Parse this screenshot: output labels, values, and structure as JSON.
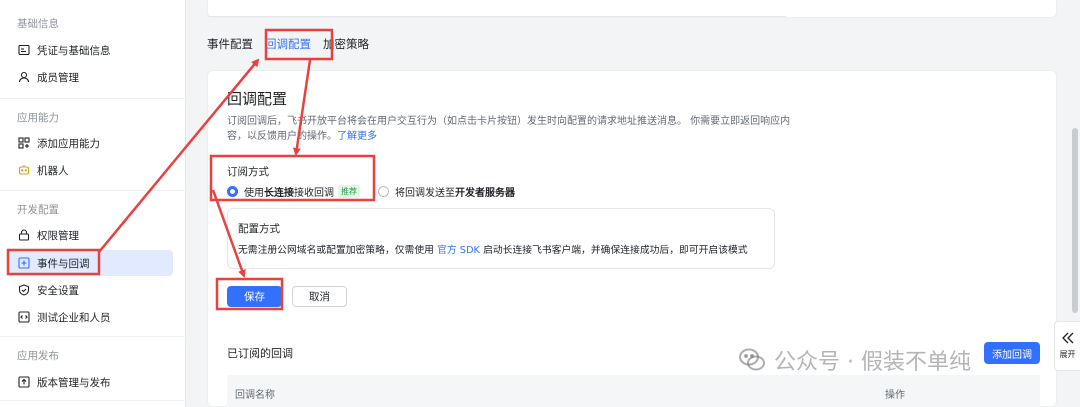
{
  "sidebar": {
    "groups": [
      {
        "title": "基础信息",
        "items": [
          {
            "label": "凭证与基础信息",
            "icon": "credential-icon"
          },
          {
            "label": "成员管理",
            "icon": "user-icon"
          }
        ]
      },
      {
        "title": "应用能力",
        "items": [
          {
            "label": "添加应用能力",
            "icon": "grid-add-icon"
          },
          {
            "label": "机器人",
            "icon": "robot-icon"
          }
        ]
      },
      {
        "title": "开发配置",
        "items": [
          {
            "label": "权限管理",
            "icon": "lock-icon"
          },
          {
            "label": "事件与回调",
            "icon": "event-icon",
            "active": true
          },
          {
            "label": "安全设置",
            "icon": "shield-icon"
          },
          {
            "label": "测试企业和人员",
            "icon": "code-icon"
          }
        ]
      },
      {
        "title": "应用发布",
        "items": [
          {
            "label": "版本管理与发布",
            "icon": "upload-icon"
          }
        ]
      }
    ]
  },
  "tabs": [
    {
      "label": "事件配置"
    },
    {
      "label": "回调配置",
      "active": true
    },
    {
      "label": "加密策略"
    }
  ],
  "main": {
    "title": "回调配置",
    "desc_line1": "订阅回调后，飞书开放平台将会在用户交互行为（如点击卡片按钮）发生时向配置的请求地址推送消息。 你需要立即返回响应内",
    "desc_line2_prefix": "容，以反馈用户的操作。",
    "desc_link": "了解更多",
    "subscribe_label": "订阅方式",
    "option1_prefix": "使用 ",
    "option1_bold": "长连接",
    "option1_suffix": " 接收回调",
    "option1_tag": "推荐",
    "option2_prefix": "将回调发送至 ",
    "option2_bold": "开发者服务器",
    "config_title": "配置方式",
    "config_text_prefix": "无需注册公网域名或配置加密策略，仅需使用 ",
    "config_link": "官方 SDK",
    "config_text_suffix": " 启动长连接飞书客户端，并确保连接成功后，即可开启该模式",
    "save_label": "保存",
    "cancel_label": "取消",
    "subscribed_title": "已订阅的回调",
    "add_label": "添加回调",
    "table_headers": {
      "name": "回调名称",
      "action": "操作"
    }
  },
  "expand_label": "展开",
  "watermark": "公众号 · 假装不单纯",
  "colors": {
    "accent": "#3370ff",
    "annotation": "#e8413e"
  }
}
